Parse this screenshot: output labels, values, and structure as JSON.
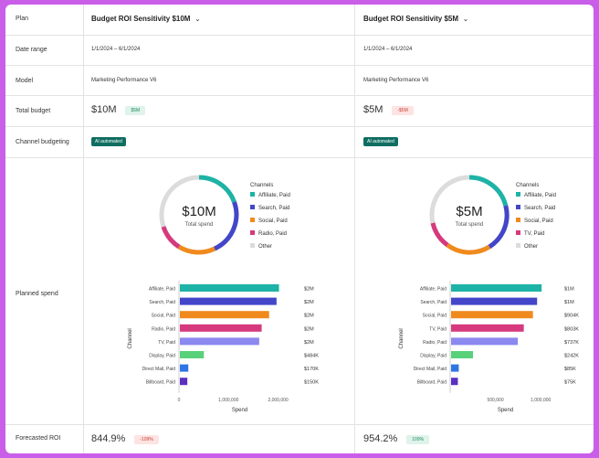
{
  "rows": {
    "plan": "Plan",
    "date_range": "Date range",
    "model": "Model",
    "total_budget": "Total budget",
    "channel_budgeting": "Channel budgeting",
    "planned_spend": "Planned spend",
    "forecasted_roi": "Forecasted ROI"
  },
  "colors": {
    "affiliate": "#1db3a6",
    "search": "#4346c8",
    "social": "#f08a1c",
    "radio_tv": "#d6397e",
    "other": "#dcdcdc",
    "tv_bar": "#8b88f0",
    "display": "#58d17a",
    "direct": "#2f76e3",
    "billboard": "#5a2fc2"
  },
  "plans": [
    {
      "name": "Budget ROI Sensitivity $10M",
      "date_range": "1/1/2024 – 6/1/2024",
      "model": "Marketing Performance V6",
      "total_budget": "$10M",
      "budget_badge": "$5M",
      "budget_badge_type": "pos",
      "channel_badge": "AI automated",
      "donut_value": "$10M",
      "donut_label": "Total spend",
      "legend_title": "Channels",
      "legend": [
        "Affiliate, Paid",
        "Search, Paid",
        "Social, Paid",
        "Radio, Paid",
        "Other"
      ],
      "forecast_roi": "844.9%",
      "roi_badge": "-109%",
      "roi_badge_type": "neg"
    },
    {
      "name": "Budget ROI Sensitivity $5M",
      "date_range": "1/1/2024 – 6/1/2024",
      "model": "Marketing Performance V6",
      "total_budget": "$5M",
      "budget_badge": "-$5M",
      "budget_badge_type": "neg",
      "channel_badge": "AI automated",
      "donut_value": "$5M",
      "donut_label": "Total spend",
      "legend_title": "Channels",
      "legend": [
        "Affiliate, Paid",
        "Search, Paid",
        "Social, Paid",
        "TV, Paid",
        "Other"
      ],
      "forecast_roi": "954.2%",
      "roi_badge": "109%",
      "roi_badge_type": "pos"
    }
  ],
  "chart_data": [
    {
      "type": "bar",
      "orientation": "horizontal",
      "categories": [
        "Affiliate, Paid",
        "Search, Paid",
        "Social, Paid",
        "Radio, Paid",
        "TV, Paid",
        "Display, Paid",
        "Direct Mail, Paid",
        "Billboard, Paid"
      ],
      "values": [
        2000000,
        1950000,
        1800000,
        1650000,
        1600000,
        484000,
        170000,
        150000
      ],
      "data_labels": [
        "$2M",
        "$2M",
        "$2M",
        "$2M",
        "$2M",
        "$484K",
        "$170K",
        "$150K"
      ],
      "xlabel": "Spend",
      "ylabel": "Channel",
      "xticks": [
        "0",
        "1,000,000",
        "2,000,000"
      ],
      "xtick_values": [
        0,
        1000000,
        2000000
      ],
      "xlim": [
        0,
        2450000
      ]
    },
    {
      "type": "bar",
      "orientation": "horizontal",
      "categories": [
        "Affiliate, Paid",
        "Search, Paid",
        "Social, Paid",
        "TV, Paid",
        "Radio, Paid",
        "Display, Paid",
        "Direct Mail, Paid",
        "Billboard, Paid"
      ],
      "values": [
        1000000,
        950000,
        904000,
        803000,
        737000,
        242000,
        85000,
        75000
      ],
      "data_labels": [
        "$1M",
        "$1M",
        "$904K",
        "$803K",
        "$737K",
        "$242K",
        "$85K",
        "$75K"
      ],
      "xlabel": "Spend",
      "ylabel": "Channel",
      "xticks": [
        "500,000",
        "1,000,000"
      ],
      "xtick_values": [
        500000,
        1000000
      ],
      "xlim": [
        0,
        1220000
      ]
    }
  ]
}
